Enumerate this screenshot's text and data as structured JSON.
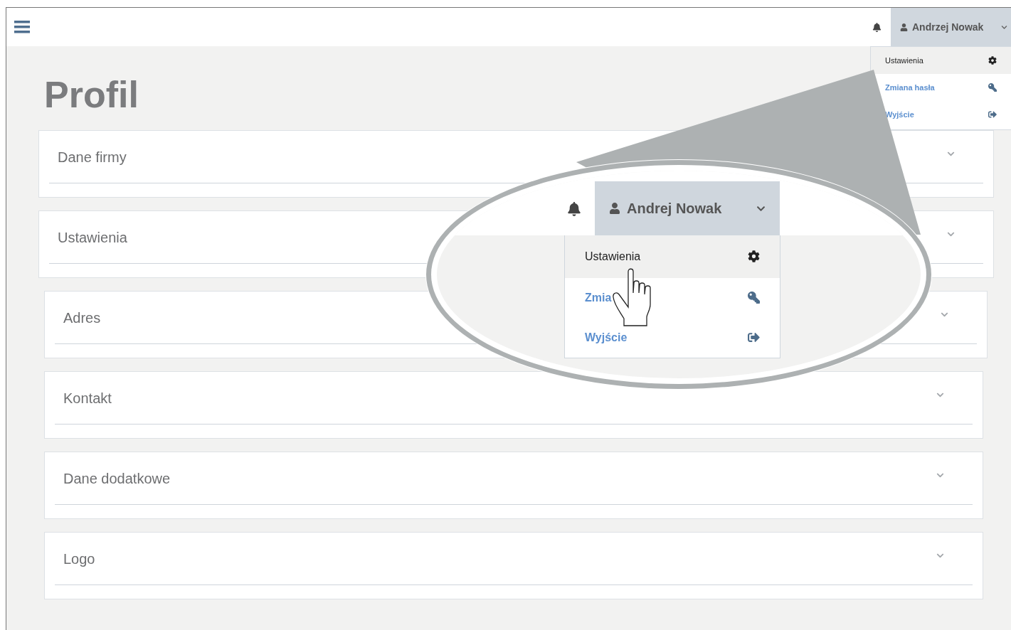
{
  "header": {
    "user": "Andrzej Nowak"
  },
  "user_menu": [
    {
      "label": "Ustawienia",
      "kind": "settings",
      "highlighted": true
    },
    {
      "label": "Zmiana hasła",
      "kind": "password",
      "highlighted": false
    },
    {
      "label": "Wyjście",
      "kind": "logout",
      "highlighted": false
    }
  ],
  "page_title": "Profil",
  "sections": [
    {
      "title": "Dane firmy",
      "expanded": false
    },
    {
      "title": "Ustawienia",
      "expanded": false
    },
    {
      "title": "Adres",
      "expanded": false
    },
    {
      "title": "Kontakt",
      "expanded": false
    },
    {
      "title": "Dane dodatkowe",
      "expanded": false
    },
    {
      "title": "Logo",
      "expanded": false
    }
  ],
  "magnifier": {
    "user": "Andrej Nowak",
    "items": [
      {
        "label": "Ustawienia",
        "kind": "settings",
        "highlighted": true
      },
      {
        "label": "Zmia",
        "kind": "password",
        "highlighted": false
      },
      {
        "label": "Wyjście",
        "kind": "logout",
        "highlighted": false
      }
    ]
  }
}
